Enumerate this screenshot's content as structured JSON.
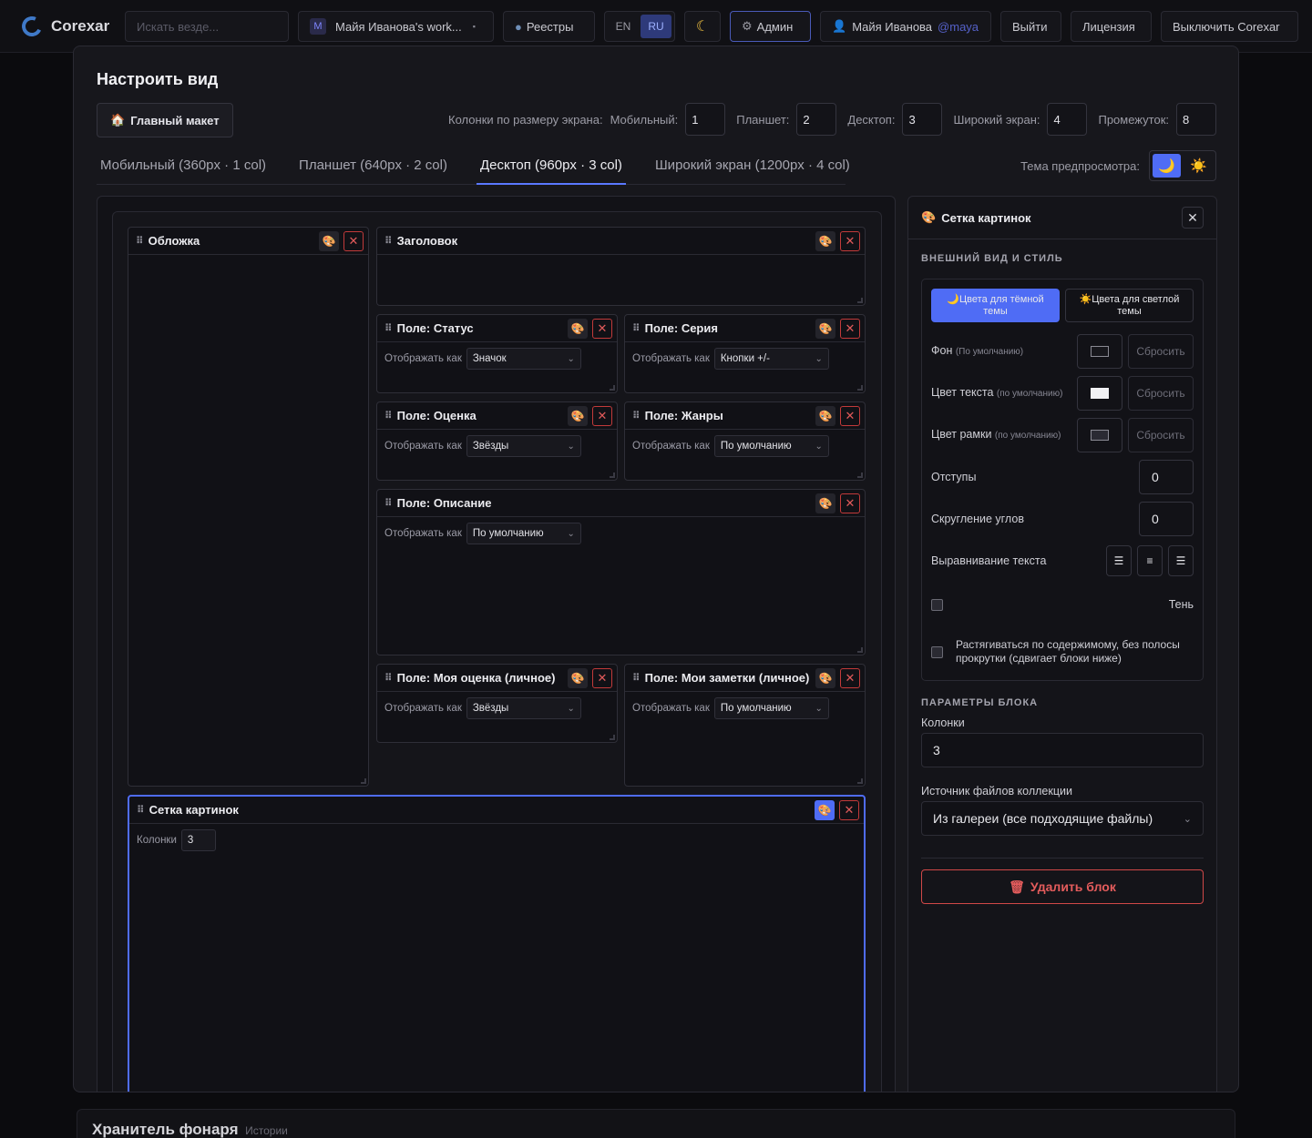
{
  "topbar": {
    "app_name": "Corexar",
    "search_placeholder": "Искать везде...",
    "workspace_badge": "M",
    "workspace": "Майя Иванова's work...",
    "registries": "Реестры",
    "lang_en": "EN",
    "lang_ru": "RU",
    "admin": "Админ",
    "user_name": "Майя Иванова",
    "user_handle": "@maya",
    "logout": "Выйти",
    "license": "Лицензия",
    "disable": "Выключить Corexar"
  },
  "modal": {
    "title": "Настроить вид",
    "main_layout": "Главный макет",
    "columns_label": "Колонки по размеру экрана:",
    "mobile_label": "Мобильный:",
    "mobile_value": "1",
    "tablet_label": "Планшет:",
    "tablet_value": "2",
    "desktop_label": "Десктоп:",
    "desktop_value": "3",
    "wide_label": "Широкий экран:",
    "wide_value": "4",
    "gap_label": "Промежуток:",
    "gap_value": "8",
    "tabs": [
      "Мобильный (360px · 1 col)",
      "Планшет (640px · 2 col)",
      "Десктоп (960px · 3 col)",
      "Широкий экран (1200px · 4 col)"
    ],
    "active_tab_index": 2,
    "preview_theme_label": "Тема предпросмотра:"
  },
  "blocks": {
    "display_as": "Отображать как",
    "cover": "Обложка",
    "header": "Заголовок",
    "status": {
      "title": "Поле: Статус",
      "value": "Значок"
    },
    "series": {
      "title": "Поле: Серия",
      "value": "Кнопки +/-"
    },
    "rating": {
      "title": "Поле: Оценка",
      "value": "Звёзды"
    },
    "genres": {
      "title": "Поле: Жанры",
      "value": "По умолчанию"
    },
    "description": {
      "title": "Поле: Описание",
      "value": "По умолчанию"
    },
    "my_rating": {
      "title": "Поле: Моя оценка (личное)",
      "value": "Звёзды"
    },
    "my_notes": {
      "title": "Поле: Мои заметки (личное)",
      "value": "По умолчанию"
    },
    "image_grid": {
      "title": "Сетка картинок",
      "columns_label": "Колонки",
      "columns_value": "3"
    }
  },
  "panel": {
    "title": "Сетка картинок",
    "appearance_section": "ВНЕШНИЙ ВИД И СТИЛЬ",
    "dark_theme_btn": "Цвета для тёмной темы",
    "light_theme_btn": "Цвета для светлой темы",
    "default_note": "(По умолчанию)",
    "default_note_lower": "(по умолчанию)",
    "bg_label": "Фон",
    "text_color_label": "Цвет текста",
    "border_color_label": "Цвет рамки",
    "reset": "Сбросить",
    "padding_label": "Отступы",
    "padding_value": "0",
    "radius_label": "Скругление углов",
    "radius_value": "0",
    "align_label": "Выравнивание текста",
    "shadow_label": "Тень",
    "stretch_label": "Растягиваться по содержимому, без полосы прокрутки (сдвигает блоки ниже)",
    "block_params_section": "ПАРАМЕТРЫ БЛОКА",
    "columns_label": "Колонки",
    "columns_value": "3",
    "source_label": "Источник файлов коллекции",
    "source_value": "Из галереи (все подходящие файлы)",
    "delete_block": "Удалить блок"
  },
  "background": {
    "title": "Хранитель фонаря",
    "subtitle": "Истории"
  },
  "colors": {
    "accent": "#4f6cf5",
    "danger": "#d04848",
    "surface": "#17171c"
  }
}
